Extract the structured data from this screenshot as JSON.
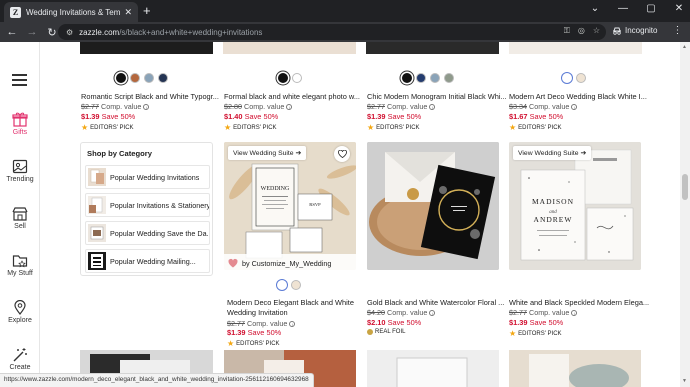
{
  "browser": {
    "tab_title": "Wedding Invitations & Templates",
    "new_tab": "+",
    "url_host": "zazzle.com",
    "url_path": "/s/black+and+white+wedding+invitations",
    "profile_label": "Incognito",
    "status_url": "https://www.zazzle.com/modern_deco_elegant_black_and_white_wedding_invitation-256112160694632968"
  },
  "sidebar": {
    "items": [
      {
        "label": "Gifts",
        "icon": "gift-icon"
      },
      {
        "label": "Trending",
        "icon": "trending-icon"
      },
      {
        "label": "Sell",
        "icon": "store-icon"
      },
      {
        "label": "My Stuff",
        "icon": "folder-icon"
      },
      {
        "label": "Explore",
        "icon": "location-pin-icon"
      },
      {
        "label": "Create",
        "icon": "magic-wand-icon"
      }
    ]
  },
  "top_row": [
    {
      "swatches": [
        "#111111",
        "#b4673d",
        "#8aa3b8",
        "#243453"
      ],
      "title": "Romantic Script Black and White Typogr...",
      "orig_price": "$2.77",
      "comp": "Comp. value",
      "sale_price": "$1.39",
      "save": "Save 50%",
      "badge": "EDITORS' PICK"
    },
    {
      "swatches": [
        "#111111",
        "#ffffff"
      ],
      "title": "Formal black and white elegant photo w...",
      "orig_price": "$2.80",
      "comp": "Comp. value",
      "sale_price": "$1.40",
      "save": "Save 50%",
      "badge": "EDITORS' PICK"
    },
    {
      "swatches": [
        "#111111",
        "#243c6e",
        "#8aa3b8",
        "#8f9a8c"
      ],
      "title": "Chic Modern Monogram Initial Black Whi...",
      "orig_price": "$2.77",
      "comp": "Comp. value",
      "sale_price": "$1.39",
      "save": "Save 50%",
      "badge": "EDITORS' PICK"
    },
    {
      "swatches": [
        "#ffffff",
        "#efe3d3"
      ],
      "title": "Modern Art Deco Wedding Black White I...",
      "orig_price": "$3.34",
      "comp": "Comp. value",
      "sale_price": "$1.67",
      "save": "Save 50%",
      "badge": "EDITORS' PICK"
    }
  ],
  "shop_by_category": {
    "heading": "Shop by Category",
    "items": [
      "Popular Wedding Invitations",
      "Popular Invitations & Stationery",
      "Popular Wedding Save the Da...",
      "Popular Wedding Mailing..."
    ]
  },
  "middle_row": [
    {
      "view_suite": "View Wedding Suite",
      "byline": "by Customize_My_Wedding",
      "swatches": [
        "#ffffff",
        "#efe3d3"
      ],
      "title_line1": "Modern Deco Elegant Black and White",
      "title_line2": "Wedding Invitation",
      "orig_price": "$2.77",
      "comp": "Comp. value",
      "sale_price": "$1.39",
      "save": "Save 50%",
      "badge": "EDITORS' PICK",
      "img_wedding": "WEDDING",
      "img_rsvp": "RSVP"
    },
    {
      "title": "Gold Black and White Watercolor Floral ...",
      "orig_price": "$4.20",
      "comp": "Comp. value",
      "sale_price": "$2.10",
      "save": "Save 50%",
      "badge": "REAL FOIL"
    },
    {
      "view_suite": "View Wedding Suite",
      "title": "White and Black Speckled Modern Elega...",
      "orig_price": "$2.77",
      "comp": "Comp. value",
      "sale_price": "$1.39",
      "save": "Save 50%",
      "badge": "EDITORS' PICK",
      "img_name1": "MADISON",
      "img_and": "and",
      "img_name2": "ANDREW"
    }
  ],
  "colors": {
    "sale_red": "#d10f2f",
    "accent_pink": "#e2336f",
    "chrome_dark": "#202124",
    "star_gold": "#f3a712"
  }
}
